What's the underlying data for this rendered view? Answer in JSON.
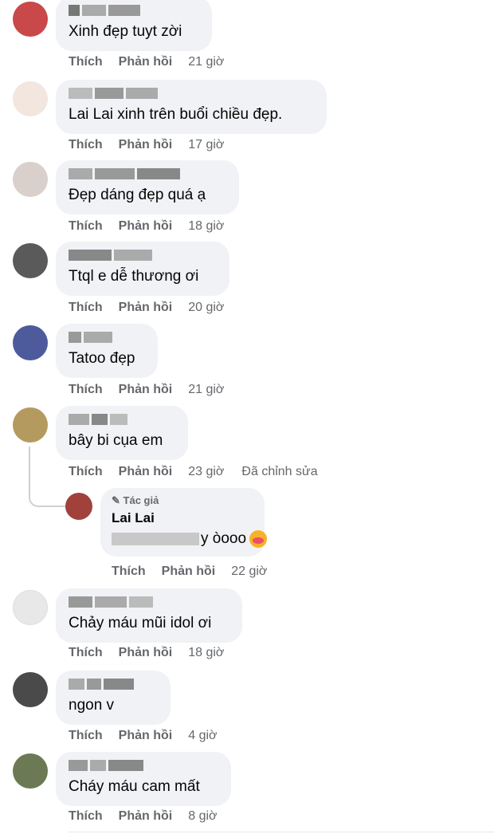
{
  "comments": [
    {
      "text": "Xinh đẹp tuyt zời",
      "like": "Thích",
      "reply": "Phản hồi",
      "time": "21 giờ"
    },
    {
      "text": "Lai Lai xinh trên buổi chiều đẹp.",
      "like": "Thích",
      "reply": "Phản hồi",
      "time": "17 giờ"
    },
    {
      "text": "Đẹp dáng đẹp quá ạ",
      "like": "Thích",
      "reply": "Phản hồi",
      "time": "18 giờ"
    },
    {
      "text": "Ttql e dễ thương ơi",
      "like": "Thích",
      "reply": "Phản hồi",
      "time": "20 giờ"
    },
    {
      "text": "Tatoo đẹp",
      "like": "Thích",
      "reply": "Phản hồi",
      "time": "21 giờ"
    },
    {
      "text": "bây bi cụa em",
      "like": "Thích",
      "reply": "Phản hồi",
      "time": "23 giờ",
      "edited": "Đã chỉnh sửa"
    },
    {
      "text": "Chảy máu mũi idol ơi",
      "like": "Thích",
      "reply": "Phản hồi",
      "time": "18 giờ"
    },
    {
      "text": "ngon v",
      "like": "Thích",
      "reply": "Phản hồi",
      "time": "4 giờ"
    },
    {
      "text": "Cháy máu cam mất",
      "like": "Thích",
      "reply": "Phản hồi",
      "time": "8 giờ"
    }
  ],
  "reply": {
    "badge": "Tác giả",
    "name": "Lai Lai",
    "text": "y òooo",
    "like": "Thích",
    "reply": "Phản hồi",
    "time": "22 giờ"
  }
}
